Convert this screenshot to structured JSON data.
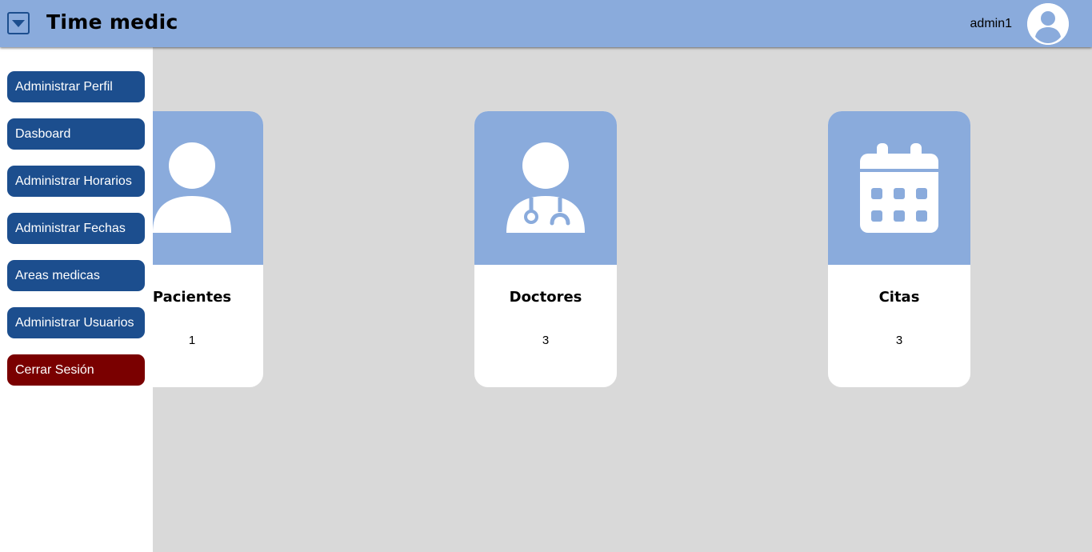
{
  "header": {
    "title": "Time medic",
    "menu_icon": "dropdown-toggle-icon",
    "user_name": "admin1",
    "avatar_icon": "user-avatar-icon"
  },
  "sidebar": {
    "items": [
      {
        "label": "Administrar Perfil"
      },
      {
        "label": "Dasboard"
      },
      {
        "label": "Administrar Horarios"
      },
      {
        "label": "Administrar Fechas"
      },
      {
        "label": "Areas medicas"
      },
      {
        "label": "Administrar Usuarios"
      },
      {
        "label": "Cerrar Sesión"
      }
    ]
  },
  "cards": [
    {
      "title": "Pacientes",
      "count": "1",
      "icon": "patient-icon"
    },
    {
      "title": "Doctores",
      "count": "3",
      "icon": "doctor-icon"
    },
    {
      "title": "Citas",
      "count": "3",
      "icon": "calendar-icon"
    }
  ],
  "colors": {
    "header_bg": "#8aabdc",
    "sidebar_button": "#1c4e8e",
    "logout_button": "#7a0000",
    "content_bg": "#d9d9d9"
  }
}
